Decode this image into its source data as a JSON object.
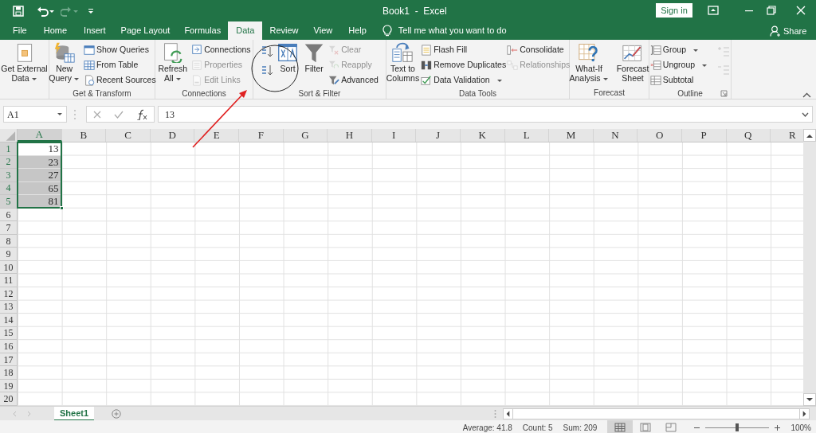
{
  "title_bar": {
    "title": "Book1  -  Excel",
    "sign_in": "Sign in"
  },
  "tabs": [
    {
      "label": "File",
      "selected": false
    },
    {
      "label": "Home",
      "selected": false
    },
    {
      "label": "Insert",
      "selected": false
    },
    {
      "label": "Page Layout",
      "selected": false
    },
    {
      "label": "Formulas",
      "selected": false
    },
    {
      "label": "Data",
      "selected": true
    },
    {
      "label": "Review",
      "selected": false
    },
    {
      "label": "View",
      "selected": false
    },
    {
      "label": "Help",
      "selected": false
    }
  ],
  "tell_me": {
    "placeholder": "Tell me what you want to do"
  },
  "share": "Share",
  "ribbon": {
    "groups": [
      {
        "columns": [
          [
            {
              "kind": "large",
              "label": "Get External\nData",
              "dropdown": true,
              "disabled": false
            }
          ]
        ]
      },
      {
        "label": "Get & Transform",
        "columns": [
          [
            {
              "kind": "large",
              "label": "New\nQuery",
              "dropdown": true,
              "disabled": false
            }
          ],
          [
            {
              "kind": "small",
              "label": "Show Queries",
              "dropdown": false,
              "disabled": false
            },
            {
              "kind": "small",
              "label": "From Table",
              "dropdown": false,
              "disabled": false
            },
            {
              "kind": "small",
              "label": "Recent Sources",
              "dropdown": false,
              "disabled": false
            }
          ]
        ]
      },
      {
        "label": "Connections",
        "columns": [
          [
            {
              "kind": "large",
              "label": "Refresh\nAll",
              "dropdown": true,
              "disabled": false
            }
          ],
          [
            {
              "kind": "small",
              "label": "Connections",
              "dropdown": false,
              "disabled": false
            },
            {
              "kind": "small",
              "label": "Properties",
              "dropdown": false,
              "disabled": true
            },
            {
              "kind": "small",
              "label": "Edit Links",
              "dropdown": false,
              "disabled": true
            }
          ]
        ]
      },
      {
        "label": "Sort & Filter",
        "columns": [
          [
            {
              "kind": "icon",
              "disabled": false
            },
            {
              "kind": "icon",
              "disabled": false
            }
          ],
          [
            {
              "kind": "large",
              "label": "Sort",
              "dropdown": false,
              "disabled": false
            }
          ],
          [
            {
              "kind": "large",
              "label": "Filter",
              "dropdown": false,
              "disabled": false
            }
          ],
          [
            {
              "kind": "small",
              "label": "Clear",
              "dropdown": false,
              "disabled": true
            },
            {
              "kind": "small",
              "label": "Reapply",
              "dropdown": false,
              "disabled": true
            },
            {
              "kind": "small",
              "label": "Advanced",
              "dropdown": false,
              "disabled": false
            }
          ]
        ]
      },
      {
        "label": "Data Tools",
        "columns": [
          [
            {
              "kind": "large",
              "label": "Text to\nColumns",
              "dropdown": false,
              "disabled": false
            }
          ],
          [
            {
              "kind": "small",
              "label": "Flash Fill",
              "dropdown": false,
              "disabled": false
            },
            {
              "kind": "small",
              "label": "Remove Duplicates",
              "dropdown": false,
              "disabled": false
            },
            {
              "kind": "small",
              "label": "Data Validation",
              "dropdown": true,
              "disabled": false
            }
          ],
          [
            {
              "kind": "small",
              "label": "Consolidate",
              "dropdown": false,
              "disabled": false
            },
            {
              "kind": "small",
              "label": "Relationships",
              "dropdown": false,
              "disabled": true
            }
          ]
        ]
      },
      {
        "label": "Forecast",
        "columns": [
          [
            {
              "kind": "large",
              "label": "What-If\nAnalysis",
              "dropdown": true,
              "disabled": false
            }
          ],
          [
            {
              "kind": "large",
              "label": "Forecast\nSheet",
              "dropdown": false,
              "disabled": false
            }
          ]
        ]
      },
      {
        "label": "Outline",
        "launcher": true,
        "columns": [
          [
            {
              "kind": "small",
              "label": "Group",
              "dropdown": true,
              "disabled": false
            },
            {
              "kind": "small",
              "label": "Ungroup",
              "dropdown": true,
              "disabled": false
            },
            {
              "kind": "small",
              "label": "Subtotal",
              "dropdown": false,
              "disabled": false
            }
          ],
          [
            {
              "kind": "icon",
              "disabled": true
            },
            {
              "kind": "icon",
              "disabled": true
            }
          ]
        ]
      }
    ]
  },
  "formula_bar": {
    "name_box": "A1",
    "formula": "13"
  },
  "sheet": {
    "columns": [
      {
        "label": "A",
        "selected": true
      },
      {
        "label": "B",
        "selected": false
      },
      {
        "label": "C",
        "selected": false
      },
      {
        "label": "D",
        "selected": false
      },
      {
        "label": "E",
        "selected": false
      },
      {
        "label": "F",
        "selected": false
      },
      {
        "label": "G",
        "selected": false
      },
      {
        "label": "H",
        "selected": false
      },
      {
        "label": "I",
        "selected": false
      },
      {
        "label": "J",
        "selected": false
      },
      {
        "label": "K",
        "selected": false
      },
      {
        "label": "L",
        "selected": false
      },
      {
        "label": "M",
        "selected": false
      },
      {
        "label": "N",
        "selected": false
      },
      {
        "label": "O",
        "selected": false
      },
      {
        "label": "P",
        "selected": false
      },
      {
        "label": "Q",
        "selected": false
      },
      {
        "label": "R",
        "selected": false
      }
    ],
    "rows": [
      {
        "label": "1",
        "selected": true,
        "cells": [
          {
            "value": "13",
            "selected": true,
            "active": true
          }
        ]
      },
      {
        "label": "2",
        "selected": true,
        "cells": [
          {
            "value": "23",
            "selected": true,
            "active": false
          }
        ]
      },
      {
        "label": "3",
        "selected": true,
        "cells": [
          {
            "value": "27",
            "selected": true,
            "active": false
          }
        ]
      },
      {
        "label": "4",
        "selected": true,
        "cells": [
          {
            "value": "65",
            "selected": true,
            "active": false
          }
        ]
      },
      {
        "label": "5",
        "selected": true,
        "cells": [
          {
            "value": "81",
            "selected": true,
            "active": false
          }
        ]
      },
      {
        "label": "6",
        "selected": false
      },
      {
        "label": "7",
        "selected": false
      },
      {
        "label": "8",
        "selected": false
      },
      {
        "label": "9",
        "selected": false
      },
      {
        "label": "10",
        "selected": false
      },
      {
        "label": "11",
        "selected": false
      },
      {
        "label": "12",
        "selected": false
      },
      {
        "label": "13",
        "selected": false
      },
      {
        "label": "14",
        "selected": false
      },
      {
        "label": "15",
        "selected": false
      },
      {
        "label": "16",
        "selected": false
      },
      {
        "label": "17",
        "selected": false
      },
      {
        "label": "18",
        "selected": false
      },
      {
        "label": "19",
        "selected": false
      },
      {
        "label": "20",
        "selected": false
      }
    ]
  },
  "sheet_tabs": [
    {
      "label": "Sheet1",
      "selected": true
    }
  ],
  "status_bar": {
    "stats": [
      "Average: 41.8",
      "Count: 5",
      "Sum: 209"
    ],
    "views": [
      {
        "kind": "normal",
        "selected": true
      },
      {
        "kind": "page_layout",
        "selected": false
      },
      {
        "kind": "page_break",
        "selected": false
      }
    ],
    "zoom": {
      "level": 0.5,
      "reading": "100%"
    }
  }
}
